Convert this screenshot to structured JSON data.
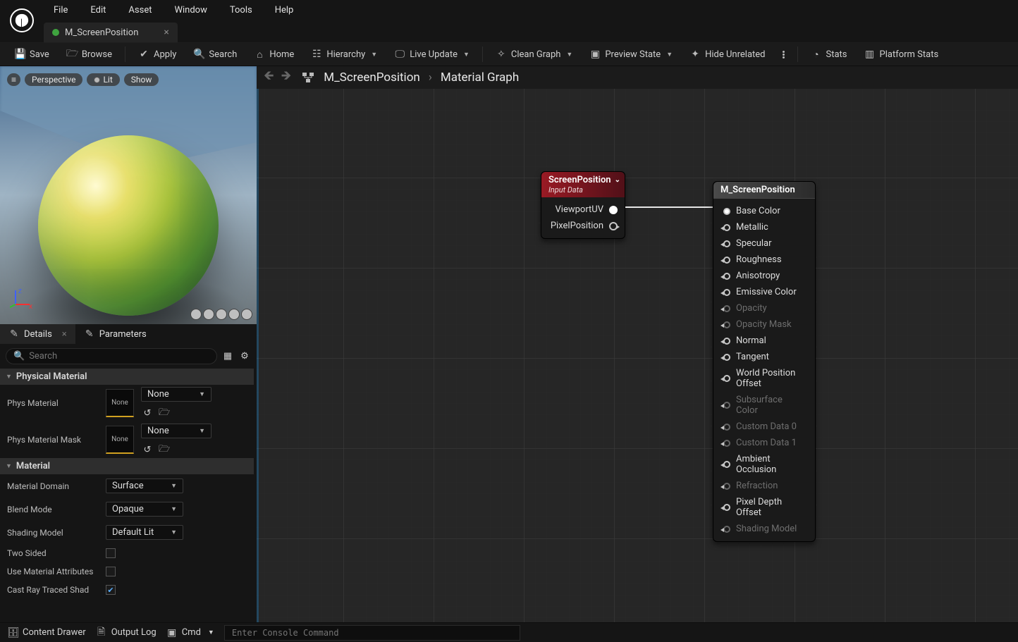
{
  "menu": {
    "items": [
      "File",
      "Edit",
      "Asset",
      "Window",
      "Tools",
      "Help"
    ]
  },
  "tab": {
    "label": "M_ScreenPosition"
  },
  "toolbar": {
    "save": "Save",
    "browse": "Browse",
    "apply": "Apply",
    "search": "Search",
    "home": "Home",
    "hierarchy": "Hierarchy",
    "live_update": "Live Update",
    "clean_graph": "Clean Graph",
    "preview_state": "Preview State",
    "hide_unrelated": "Hide Unrelated",
    "stats": "Stats",
    "platform_stats": "Platform Stats"
  },
  "viewport": {
    "menu": "≡",
    "perspective": "Perspective",
    "lit": "Lit",
    "show": "Show"
  },
  "panel_tabs": {
    "details": "Details",
    "parameters": "Parameters"
  },
  "search": {
    "placeholder": "Search"
  },
  "details": {
    "cat_phys_mat": "Physical Material",
    "phys_material": "Phys Material",
    "phys_material_mask": "Phys Material Mask",
    "none": "None",
    "cat_material": "Material",
    "material_domain": "Material Domain",
    "material_domain_val": "Surface",
    "blend_mode": "Blend Mode",
    "blend_mode_val": "Opaque",
    "shading_model": "Shading Model",
    "shading_model_val": "Default Lit",
    "two_sided": "Two Sided",
    "use_mat_attrs": "Use Material Attributes",
    "cast_rt": "Cast Ray Traced Shad"
  },
  "breadcrumb": {
    "root": "M_ScreenPosition",
    "leaf": "Material Graph"
  },
  "node_sp": {
    "title": "ScreenPosition",
    "subtitle": "Input Data",
    "outputs": [
      "ViewportUV",
      "PixelPosition"
    ]
  },
  "node_main": {
    "title": "M_ScreenPosition",
    "inputs": [
      {
        "label": "Base Color",
        "enabled": true,
        "connected": true
      },
      {
        "label": "Metallic",
        "enabled": true
      },
      {
        "label": "Specular",
        "enabled": true
      },
      {
        "label": "Roughness",
        "enabled": true
      },
      {
        "label": "Anisotropy",
        "enabled": true
      },
      {
        "label": "Emissive Color",
        "enabled": true
      },
      {
        "label": "Opacity",
        "enabled": false
      },
      {
        "label": "Opacity Mask",
        "enabled": false
      },
      {
        "label": "Normal",
        "enabled": true
      },
      {
        "label": "Tangent",
        "enabled": true
      },
      {
        "label": "World Position Offset",
        "enabled": true
      },
      {
        "label": "Subsurface Color",
        "enabled": false
      },
      {
        "label": "Custom Data 0",
        "enabled": false
      },
      {
        "label": "Custom Data 1",
        "enabled": false
      },
      {
        "label": "Ambient Occlusion",
        "enabled": true
      },
      {
        "label": "Refraction",
        "enabled": false
      },
      {
        "label": "Pixel Depth Offset",
        "enabled": true
      },
      {
        "label": "Shading Model",
        "enabled": false
      }
    ]
  },
  "statusbar": {
    "content_drawer": "Content Drawer",
    "output_log": "Output Log",
    "cmd": "Cmd",
    "console_placeholder": "Enter Console Command"
  }
}
